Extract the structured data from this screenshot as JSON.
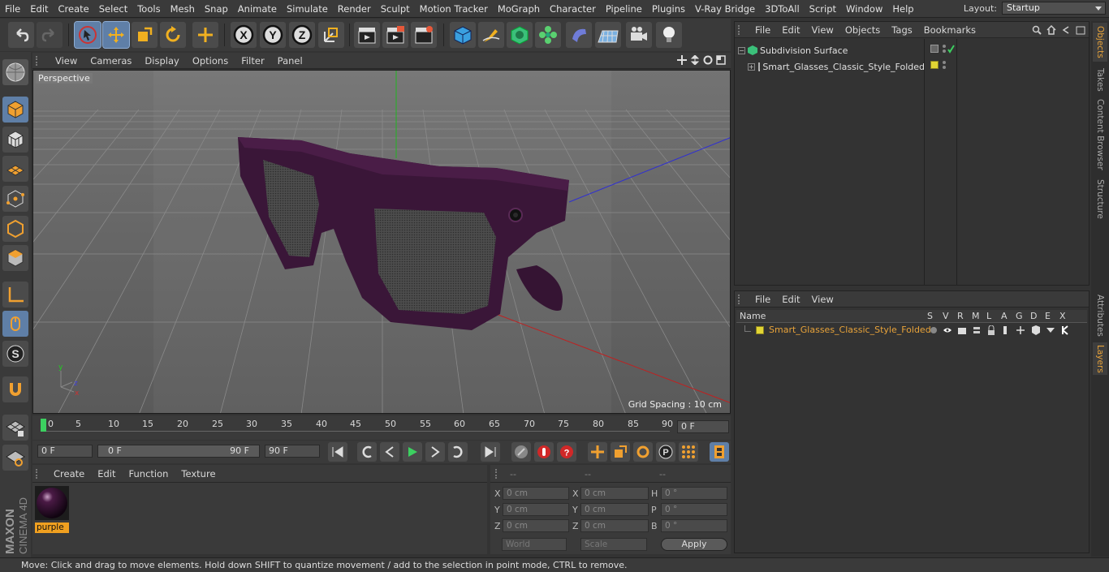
{
  "menu": [
    "File",
    "Edit",
    "Create",
    "Select",
    "Tools",
    "Mesh",
    "Snap",
    "Animate",
    "Simulate",
    "Render",
    "Sculpt",
    "Motion Tracker",
    "MoGraph",
    "Character",
    "Pipeline",
    "Plugins",
    "V-Ray Bridge",
    "3DToAll",
    "Script",
    "Window",
    "Help"
  ],
  "layout": {
    "label": "Layout:",
    "value": "Startup"
  },
  "viewport": {
    "menu": [
      "View",
      "Cameras",
      "Display",
      "Options",
      "Filter",
      "Panel"
    ],
    "label": "Perspective",
    "grid": "Grid Spacing : 10 cm"
  },
  "timeline": {
    "ticks": [
      "0",
      "5",
      "10",
      "15",
      "20",
      "25",
      "30",
      "35",
      "40",
      "45",
      "50",
      "55",
      "60",
      "65",
      "70",
      "75",
      "80",
      "85",
      "90"
    ],
    "frame_field": "0 F"
  },
  "transport": {
    "start": "0 F",
    "range_left": "0 F",
    "range_right": "90 F",
    "end": "90 F"
  },
  "material": {
    "menu": [
      "Create",
      "Edit",
      "Function",
      "Texture"
    ],
    "name": "purple"
  },
  "coords": {
    "header": [
      "--",
      "--",
      "--"
    ],
    "rows": [
      {
        "a": "X",
        "av": "0 cm",
        "b": "X",
        "bv": "0 cm",
        "c": "H",
        "cv": "0 °"
      },
      {
        "a": "Y",
        "av": "0 cm",
        "b": "Y",
        "bv": "0 cm",
        "c": "P",
        "cv": "0 °"
      },
      {
        "a": "Z",
        "av": "0 cm",
        "b": "Z",
        "bv": "0 cm",
        "c": "B",
        "cv": "0 °"
      }
    ],
    "world": "World",
    "scale": "Scale",
    "apply": "Apply"
  },
  "objects": {
    "menu": [
      "File",
      "Edit",
      "View",
      "Objects",
      "Tags",
      "Bookmarks"
    ],
    "items": [
      "Subdivision Surface",
      "Smart_Glasses_Classic_Style_Folded"
    ]
  },
  "layers": {
    "menu": [
      "File",
      "Edit",
      "View"
    ],
    "cols": [
      "Name",
      "S",
      "V",
      "R",
      "M",
      "L",
      "A",
      "G",
      "D",
      "E",
      "X"
    ],
    "item": "Smart_Glasses_Classic_Style_Folded"
  },
  "sidetabs": [
    "Objects",
    "Takes",
    "Content Browser",
    "Structure",
    "Attributes",
    "Layers"
  ],
  "status": "Move: Click and drag to move elements. Hold down SHIFT to quantize movement / add to the selection in point mode, CTRL to remove.",
  "brand": {
    "maxon": "MAXON",
    "product": "CINEMA 4D"
  },
  "colors": {
    "accent": "#e8a33a",
    "object_purple": "#3a1638",
    "selected_tool": "#5f7fa7"
  }
}
